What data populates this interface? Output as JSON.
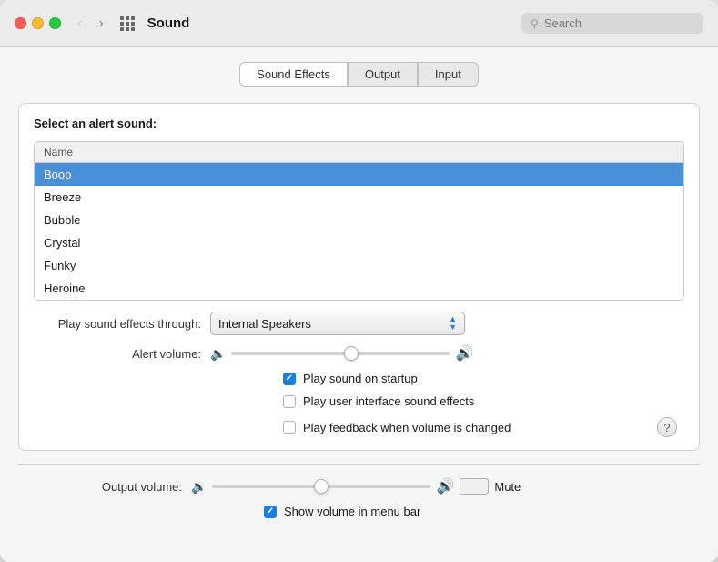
{
  "window": {
    "title": "Sound",
    "search_placeholder": "Search"
  },
  "tabs": [
    {
      "id": "sound-effects",
      "label": "Sound Effects",
      "active": true
    },
    {
      "id": "output",
      "label": "Output",
      "active": false
    },
    {
      "id": "input",
      "label": "Input",
      "active": false
    }
  ],
  "panel": {
    "section_label": "Select an alert sound:",
    "list_header": "Name",
    "sounds": [
      {
        "name": "Boop",
        "selected": true
      },
      {
        "name": "Breeze",
        "selected": false
      },
      {
        "name": "Bubble",
        "selected": false
      },
      {
        "name": "Crystal",
        "selected": false
      },
      {
        "name": "Funky",
        "selected": false
      },
      {
        "name": "Heroine",
        "selected": false
      }
    ],
    "play_through_label": "Play sound effects through:",
    "play_through_value": "Internal Speakers",
    "alert_volume_label": "Alert volume:",
    "alert_volume": 55,
    "checkboxes": [
      {
        "id": "startup",
        "label": "Play sound on startup",
        "checked": true
      },
      {
        "id": "ui-effects",
        "label": "Play user interface sound effects",
        "checked": false
      },
      {
        "id": "feedback",
        "label": "Play feedback when volume is changed",
        "checked": false
      }
    ]
  },
  "bottom": {
    "output_volume_label": "Output volume:",
    "output_volume": 50,
    "mute_label": "Mute",
    "show_volume_label": "Show volume in menu bar",
    "show_volume_checked": true
  },
  "icons": {
    "volume_low": "🔈",
    "volume_high": "🔊",
    "search": "🔍",
    "dropdown_arrow": "⬍"
  }
}
